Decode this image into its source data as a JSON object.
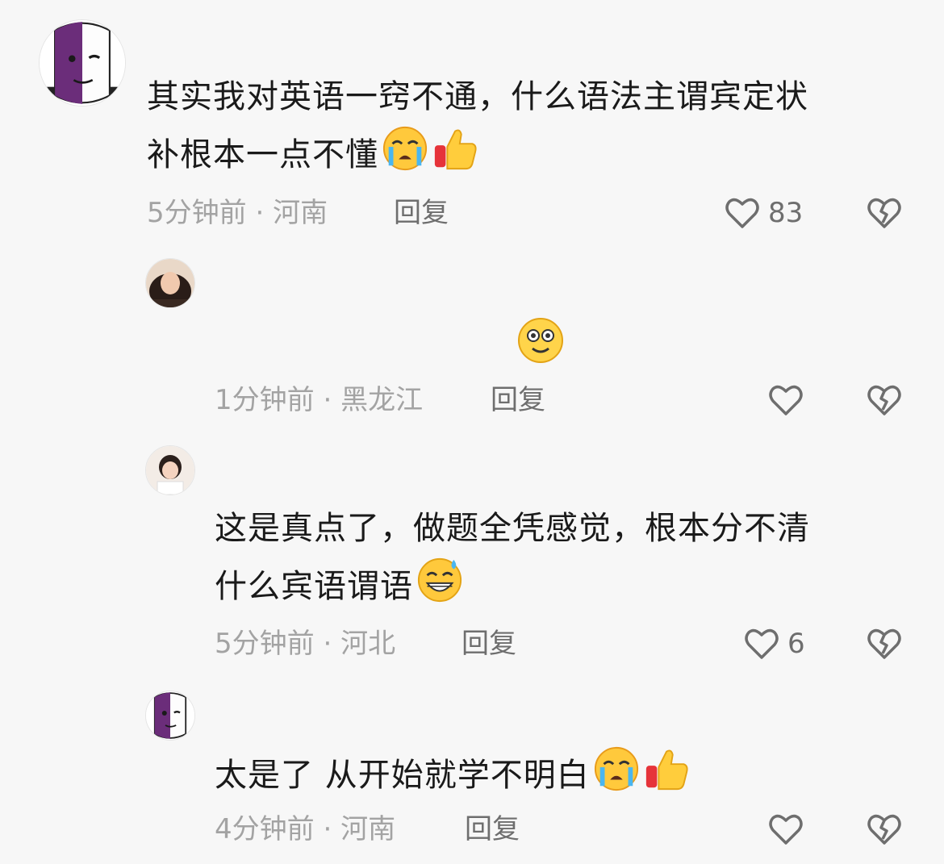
{
  "comments": [
    {
      "text_line1": "其实我对英语一窍不通，什么语法主谓宾定状",
      "text_line2": "补根本一点不懂",
      "emojis": [
        "loudly-crying-face",
        "thumbs-up"
      ],
      "time": "5分钟前",
      "location": "河南",
      "reply_label": "回复",
      "like_count": "83"
    },
    {
      "text_line1": "",
      "emojis": [
        "smiling-face-emoji"
      ],
      "time": "1分钟前",
      "location": "黑龙江",
      "reply_label": "回复",
      "like_count": ""
    },
    {
      "text_line1": "这是真点了，做题全凭感觉，根本分不清",
      "text_line2": "什么宾语谓语",
      "emojis": [
        "grinning-face-with-sweat"
      ],
      "time": "5分钟前",
      "location": "河北",
      "reply_label": "回复",
      "like_count": "6"
    },
    {
      "text_line1": "太是了 从开始就学不明白",
      "emojis": [
        "loudly-crying-face",
        "thumbs-up"
      ],
      "time": "4分钟前",
      "location": "河南",
      "reply_label": "回复",
      "like_count": ""
    }
  ],
  "separator": " · ",
  "icons": {
    "like": "heart-outline-icon",
    "dislike": "broken-heart-icon"
  },
  "colors": {
    "background": "#f7f7f7",
    "meta": "#a3a3a3",
    "reply": "#6e6e6e",
    "avatar_purple": "#6b2d7a"
  }
}
